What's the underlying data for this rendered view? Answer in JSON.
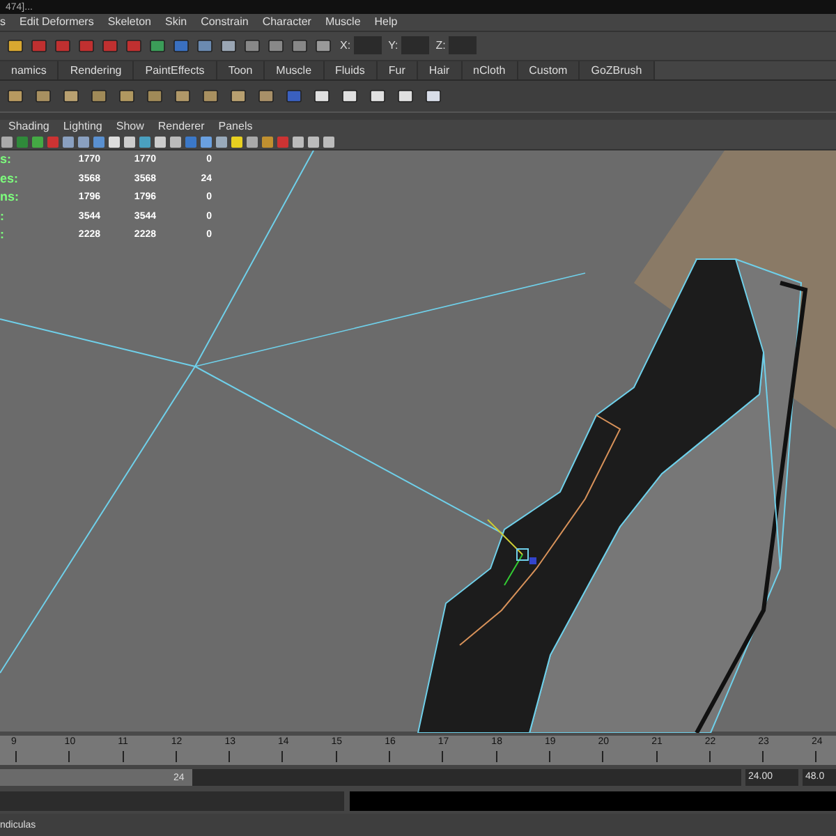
{
  "window": {
    "title": "474]..."
  },
  "menu": [
    "s",
    "Edit Deformers",
    "Skeleton",
    "Skin",
    "Constrain",
    "Character",
    "Muscle",
    "Help"
  ],
  "toolbar": {
    "fields": [
      {
        "label": "X:"
      },
      {
        "label": "Y:"
      },
      {
        "label": "Z:"
      }
    ]
  },
  "shelf_tabs": [
    {
      "label": "namics",
      "selected": false
    },
    {
      "label": "Rendering",
      "selected": false
    },
    {
      "label": "PaintEffects",
      "selected": false
    },
    {
      "label": "Toon",
      "selected": false
    },
    {
      "label": "Muscle",
      "selected": false
    },
    {
      "label": "Fluids",
      "selected": false
    },
    {
      "label": "Fur",
      "selected": false
    },
    {
      "label": "Hair",
      "selected": false
    },
    {
      "label": "nCloth",
      "selected": false
    },
    {
      "label": "Custom",
      "selected": false
    },
    {
      "label": "GoZBrush",
      "selected": false
    }
  ],
  "panel_menu": [
    "Shading",
    "Lighting",
    "Show",
    "Renderer",
    "Panels"
  ],
  "stats": [
    {
      "label": "s:",
      "column_2": "1770",
      "column_3": "1770",
      "column_4": "0"
    },
    {
      "label": "es:",
      "column_2": "3568",
      "column_3": "3568",
      "column_4": "24"
    },
    {
      "label": "ns:",
      "column_2": "1796",
      "column_3": "1796",
      "column_4": "0"
    },
    {
      "label": ":",
      "column_2": "3544",
      "column_3": "3544",
      "column_4": "0"
    },
    {
      "label": ":",
      "column_2": "2228",
      "column_3": "2228",
      "column_4": "0"
    }
  ],
  "timeline": {
    "ticks": [
      "9",
      "10",
      "11",
      "12",
      "13",
      "14",
      "15",
      "16",
      "17",
      "18",
      "19",
      "20",
      "21",
      "22",
      "23",
      "24"
    ]
  },
  "range": {
    "slider_value": "24",
    "level": 0.26,
    "start": "24.00",
    "end": "48.0"
  },
  "help_line": "ndiculas"
}
